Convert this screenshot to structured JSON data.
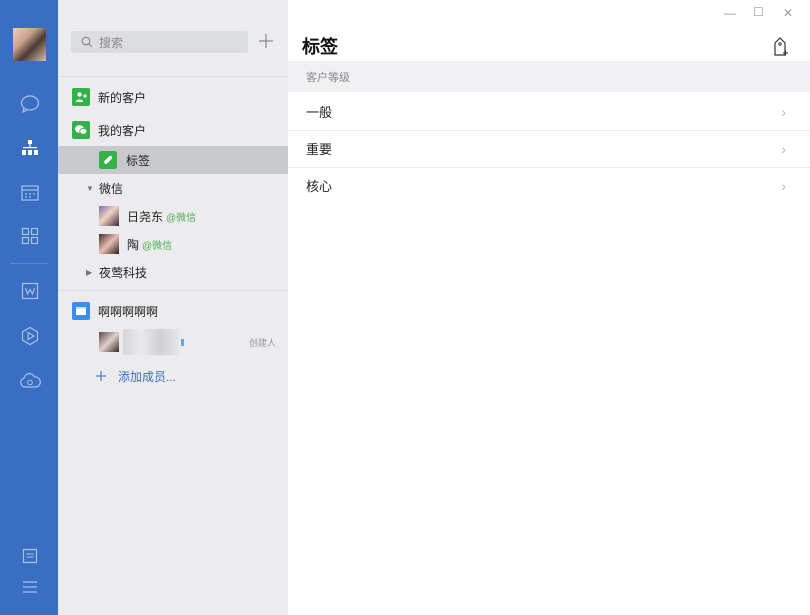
{
  "sidebar": {
    "icons": [
      "chat-icon",
      "org-chart-icon",
      "calendar-icon",
      "apps-grid-icon",
      "document-icon",
      "hexagon-icon",
      "cloud-icon",
      "notes-icon",
      "menu-icon"
    ]
  },
  "contacts": {
    "search_placeholder": "搜索",
    "new_customers": "新的客户",
    "my_customers": "我的客户",
    "tags": "标签",
    "wechat_group": "微信",
    "contact1_name": "日尧东",
    "contact1_src": "@微信",
    "contact2_name": "陶",
    "contact2_src": "@微信",
    "company": "夜莺科技",
    "team_name": "啊啊啊啊啊",
    "member_role": "创建人",
    "add_member": "添加成员..."
  },
  "main": {
    "title": "标签",
    "section_label": "客户等级",
    "levels": [
      "一般",
      "重要",
      "核心"
    ]
  },
  "colors": {
    "rail": "#3a6ec2",
    "green": "#36b04a",
    "blue": "#3b8ef0"
  }
}
